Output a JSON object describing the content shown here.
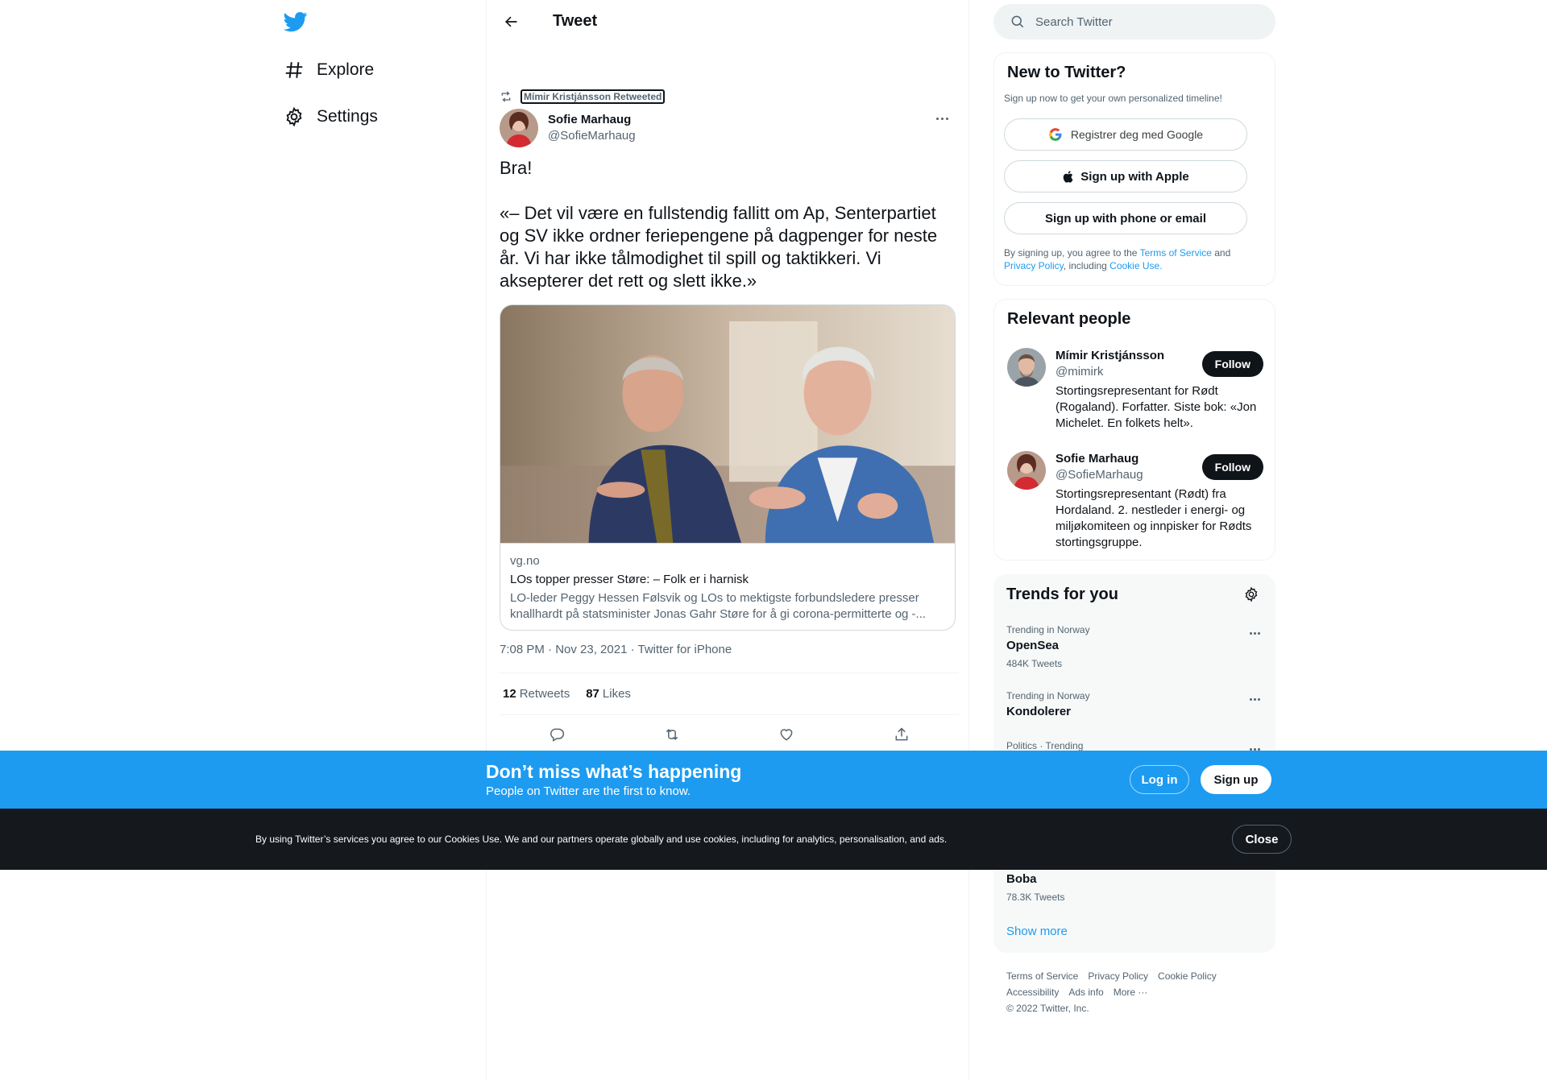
{
  "nav": {
    "items": [
      {
        "label": "Explore",
        "icon": "hashtag-icon"
      },
      {
        "label": "Settings",
        "icon": "gear-icon"
      }
    ]
  },
  "header": {
    "title": "Tweet"
  },
  "tweet": {
    "social_context": "Mímir Kristjánsson Retweeted",
    "author_name": "Sofie Marhaug",
    "author_handle": "@SofieMarhaug",
    "text": "Bra!\n\n«– Det vil være en fullstendig fallitt om Ap, Senterpartiet og SV ikke ordner feriepengene på dagpenger for neste år. Vi har ikke tålmodighet til spill og taktikkeri. Vi aksepterer det rett og slett ikke.»",
    "card": {
      "domain": "vg.no",
      "title": "LOs topper presser Støre: – Folk er i harnisk",
      "description": "LO-leder Peggy Hessen Følsvik og LOs to mektigste forbundsledere presser knallhardt på statsminister Jonas Gahr Støre for å gi corona-permitterte og -..."
    },
    "meta": "7:08 PM · Nov 23, 2021 · Twitter for iPhone",
    "retweets_count": "12",
    "retweets_label": "Retweets",
    "likes_count": "87",
    "likes_label": "Likes"
  },
  "search": {
    "placeholder": "Search Twitter"
  },
  "signup": {
    "title": "New to Twitter?",
    "subtitle": "Sign up now to get your own personalized timeline!",
    "google_label": "Registrer deg med Google",
    "apple_label": "Sign up with Apple",
    "phone_label": "Sign up with phone or email",
    "terms_prefix": "By signing up, you agree to the ",
    "terms_link": "Terms of Service",
    "terms_and": " and ",
    "privacy_link": "Privacy Policy",
    "terms_including": ", including ",
    "cookie_link": "Cookie Use."
  },
  "people": {
    "title": "Relevant people",
    "list": [
      {
        "name": "Mímir Kristjánsson",
        "handle": "@mimirk",
        "bio": "Stortingsrepresentant for Rødt (Rogaland). Forfatter. Siste bok: «Jon Michelet. En folkets helt».",
        "follow_label": "Follow"
      },
      {
        "name": "Sofie Marhaug",
        "handle": "@SofieMarhaug",
        "bio": "Stortingsrepresentant (Rødt) fra Hordaland. 2. nestleder i energi- og miljøkomiteen og innpisker for Rødts stortingsgruppe.",
        "follow_label": "Follow"
      }
    ]
  },
  "trends": {
    "title": "Trends for you",
    "items": [
      {
        "context": "Trending in Norway",
        "name": "OpenSea",
        "count": "484K Tweets"
      },
      {
        "context": "Trending in Norway",
        "name": "Kondolerer",
        "count": ""
      },
      {
        "context": "Politics · Trending",
        "name": "",
        "count": ""
      },
      {
        "context": "",
        "name": "Boba",
        "count": "78.3K Tweets"
      }
    ],
    "show_more": "Show more"
  },
  "footer": {
    "links": [
      "Terms of Service",
      "Privacy Policy",
      "Cookie Policy",
      "Accessibility",
      "Ads info",
      "More ···"
    ],
    "copyright": "© 2022 Twitter, Inc."
  },
  "banner": {
    "title": "Don’t miss what’s happening",
    "subtitle": "People on Twitter are the first to know.",
    "login_label": "Log in",
    "signup_label": "Sign up"
  },
  "cookie": {
    "text": "By using Twitter’s services you agree to our Cookies Use. We and our partners operate globally and use cookies, including for analytics, personalisation, and ads.",
    "close_label": "Close"
  },
  "colors": {
    "accent": "#1d9bf0",
    "text": "#0f1419",
    "secondary": "#536471"
  }
}
